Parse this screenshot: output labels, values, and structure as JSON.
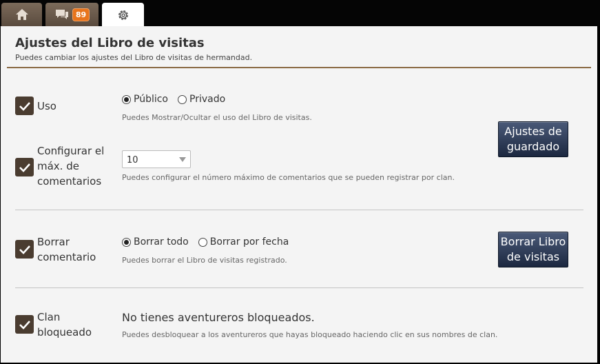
{
  "tabs": {
    "home_icon": "home-icon",
    "chat_icon": "chat-icon",
    "chat_badge": "89",
    "settings_icon": "gear-icon"
  },
  "header": {
    "title": "Ajustes del Libro de visitas",
    "subtitle": "Puedes cambiar los ajustes del Libro de visitas de hermandad."
  },
  "usage": {
    "label": "Uso",
    "options": [
      "Público",
      "Privado"
    ],
    "selected": "Público",
    "hint": "Puedes Mostrar/Ocultar el uso del Libro de visitas."
  },
  "max_comments": {
    "label_line1": "Configurar el",
    "label_line2": "máx. de",
    "label_line3": "comentarios",
    "value": "10",
    "hint": "Puedes configurar el número máximo de comentarios que se pueden registrar por clan."
  },
  "save_button": {
    "line1": "Ajustes de",
    "line2": "guardado"
  },
  "delete": {
    "label_line1": "Borrar",
    "label_line2": "comentario",
    "options": [
      "Borrar todo",
      "Borrar por fecha"
    ],
    "selected": "Borrar todo",
    "hint": "Puedes borrar el Libro de visitas registrado.",
    "button_line1": "Borrar Libro",
    "button_line2": "de visitas"
  },
  "blocked": {
    "label_line1": "Clan",
    "label_line2": "bloqueado",
    "message": "No tienes aventureros bloqueados.",
    "hint": "Puedes desbloquear a los aventureros que hayas bloqueado haciendo clic en sus nombres de clan."
  },
  "colors": {
    "accent_line": "#8a6a44",
    "checkbox": "#4a3c30",
    "button": "#1c2840",
    "badge": "#e8741c"
  }
}
